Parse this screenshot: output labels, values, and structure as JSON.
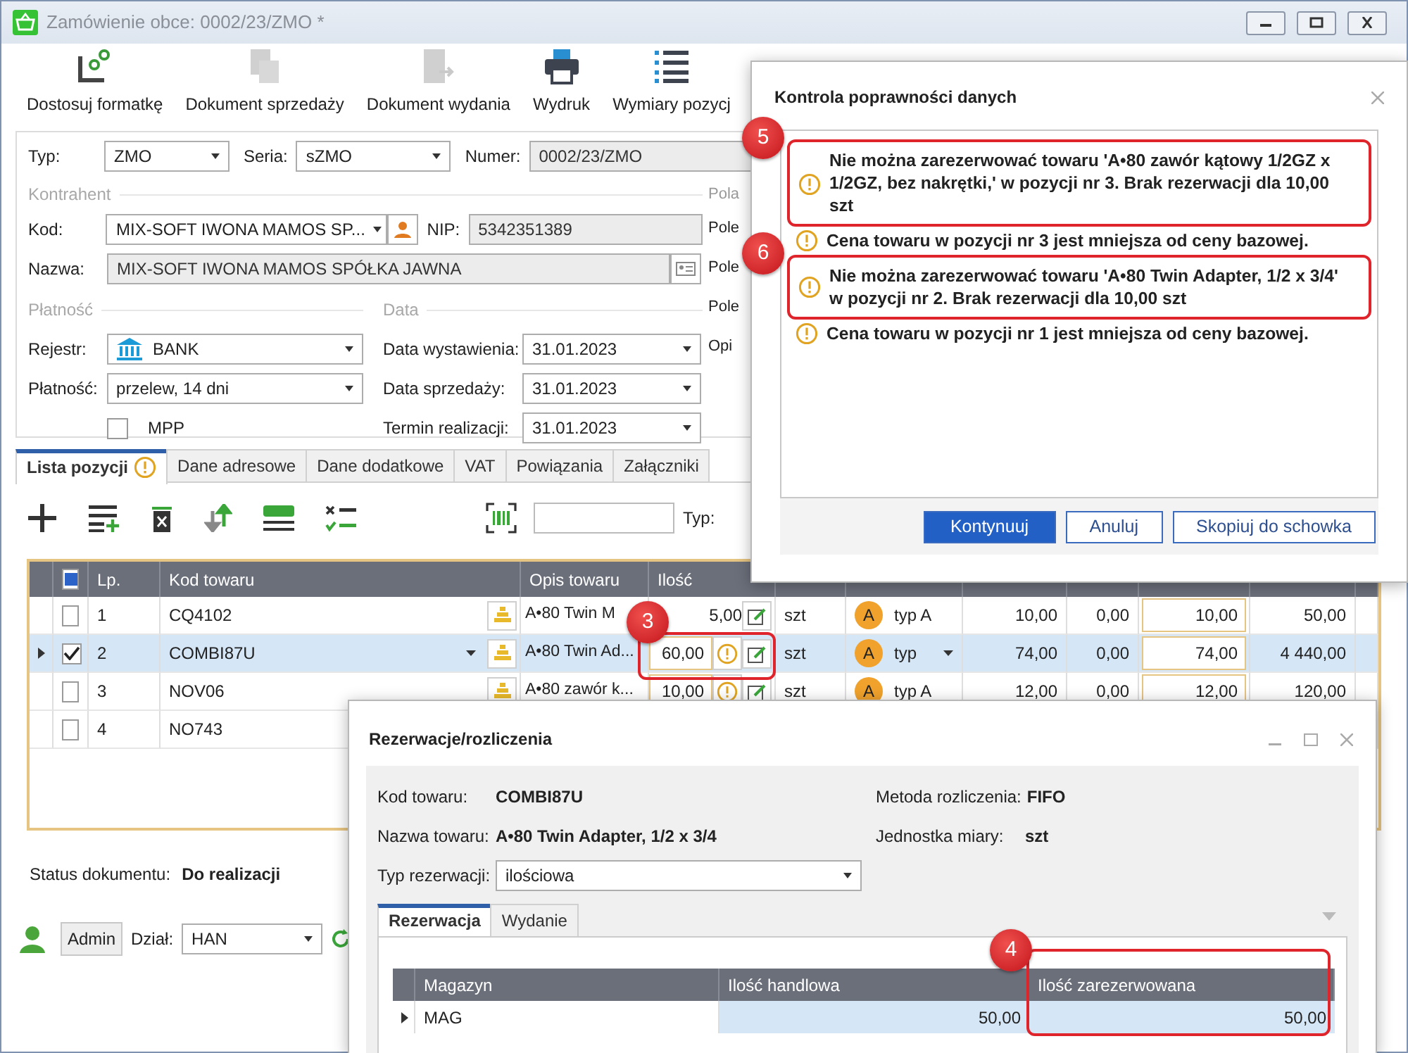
{
  "window": {
    "title": "Zamówienie obce: 0002/23/ZMO *"
  },
  "toolbar": [
    {
      "label": "Dostosuj formatkę",
      "kind": "customize",
      "disabled": false
    },
    {
      "label": "Dokument sprzedaży",
      "kind": "document",
      "disabled": true
    },
    {
      "label": "Dokument wydania",
      "kind": "export",
      "disabled": true
    },
    {
      "label": "Wydruk",
      "kind": "print",
      "disabled": false
    },
    {
      "label": "Wymiary pozycj",
      "kind": "list",
      "disabled": false
    }
  ],
  "header": {
    "typ_label": "Typ:",
    "typ": "ZMO",
    "seria_label": "Seria:",
    "seria": "sZMO",
    "numer_label": "Numer:",
    "numer": "0002/23/ZMO"
  },
  "kontrahent": {
    "title": "Kontrahent",
    "kod_label": "Kod:",
    "kod": "MIX-SOFT IWONA MAMOS SP...",
    "nip_label": "NIP:",
    "nip": "5342351389",
    "nazwa_label": "Nazwa:",
    "nazwa": "MIX-SOFT IWONA MAMOS SPÓŁKA JAWNA"
  },
  "platnosc": {
    "title": "Płatność",
    "rejestr_label": "Rejestr:",
    "rejestr": "BANK",
    "platnosc_label": "Płatność:",
    "platnosc": "przelew, 14 dni",
    "mpp_label": "MPP",
    "mpp_checked": false
  },
  "data": {
    "title": "Data",
    "fields": [
      {
        "label": "Data wystawienia:",
        "value": "31.01.2023"
      },
      {
        "label": "Data sprzedaży:",
        "value": "31.01.2023"
      },
      {
        "label": "Termin realizacji:",
        "value": "31.01.2023"
      }
    ]
  },
  "pola": {
    "title": "Pola",
    "labels": [
      "Pole",
      "Pole",
      "Pole",
      "Opi"
    ]
  },
  "tabs": [
    {
      "label": "Lista pozycji",
      "selected": true,
      "warning": true
    },
    {
      "label": "Dane adresowe",
      "selected": false,
      "warning": false
    },
    {
      "label": "Dane dodatkowe",
      "selected": false,
      "warning": false
    },
    {
      "label": "VAT",
      "selected": false,
      "warning": false
    },
    {
      "label": "Powiązania",
      "selected": false,
      "warning": false
    },
    {
      "label": "Załączniki",
      "selected": false,
      "warning": false
    }
  ],
  "grid_toolbar": {
    "typ_label": "Typ:"
  },
  "items": {
    "select_all_partial": true,
    "columns": [
      "Lp.",
      "Kod towaru",
      "Opis towaru",
      "Ilość"
    ],
    "rows": [
      {
        "lp": "1",
        "selected": false,
        "checked": false,
        "kod": "CQ4102",
        "opis": "A•80 Twin M",
        "ilosc": "5,00",
        "warning": false,
        "jm": "szt",
        "price_badge": "A",
        "typ_ceny": "typ A",
        "cena_cennik": "10,00",
        "rabat": "0,00",
        "cena_netto": "10,00",
        "wartosc": "50,00"
      },
      {
        "lp": "2",
        "selected": true,
        "checked": true,
        "kod": "COMBI87U",
        "opis": "A•80 Twin Ad...",
        "ilosc": "60,00",
        "warning": true,
        "marker": "3",
        "jm": "szt",
        "price_badge": "A",
        "typ_ceny": "typ",
        "cena_cennik": "74,00",
        "rabat": "0,00",
        "cena_netto": "74,00",
        "wartosc": "4 440,00"
      },
      {
        "lp": "3",
        "selected": false,
        "checked": false,
        "kod": "NOV06",
        "opis": "A•80 zawór k...",
        "ilosc": "10,00",
        "warning": true,
        "jm": "szt",
        "price_badge": "A",
        "typ_ceny": "typ A",
        "cena_cennik": "12,00",
        "rabat": "0,00",
        "cena_netto": "12,00",
        "wartosc": "120,00"
      },
      {
        "lp": "4",
        "selected": false,
        "checked": false,
        "kod": "NO743"
      }
    ]
  },
  "status": {
    "label": "Status dokumentu:",
    "value": "Do realizacji"
  },
  "footer": {
    "user": "Admin",
    "dzial_label": "Dział:",
    "dzial": "HAN"
  },
  "validation_dialog": {
    "title": "Kontrola poprawności danych",
    "messages": [
      {
        "text": "Nie można zarezerwować towaru 'A•80 zawór kątowy 1/2GZ x 1/2GZ, bez nakrętki,' w pozycji nr 3. Brak rezerwacji dla 10,00 szt",
        "highlighted": true,
        "marker": "5"
      },
      {
        "text": "Cena towaru w pozycji nr 3 jest mniejsza od ceny bazowej.",
        "highlighted": false
      },
      {
        "text": "Nie można zarezerwować towaru 'A•80 Twin Adapter, 1/2 x 3/4' w pozycji nr 2. Brak rezerwacji dla 10,00 szt",
        "highlighted": true,
        "marker": "6"
      },
      {
        "text": "Cena towaru w pozycji nr 1 jest mniejsza od ceny bazowej.",
        "highlighted": false
      }
    ],
    "buttons": [
      {
        "label": "Kontynuuj",
        "kind": "primary"
      },
      {
        "label": "Anuluj",
        "kind": "secondary"
      },
      {
        "label": "Skopiuj do schowka",
        "kind": "secondary"
      }
    ]
  },
  "reservation_dialog": {
    "title": "Rezerwacje/rozliczenia",
    "kod_label": "Kod towaru:",
    "kod": "COMBI87U",
    "metoda_label": "Metoda rozliczenia:",
    "metoda": "FIFO",
    "nazwa_label": "Nazwa towaru:",
    "nazwa": "A•80 Twin Adapter, 1/2 x 3/4",
    "jm_label": "Jednostka miary:",
    "jm": "szt",
    "typ_label": "Typ rezerwacji:",
    "typ": "ilościowa",
    "tabs": [
      {
        "label": "Rezerwacja",
        "selected": true
      },
      {
        "label": "Wydanie",
        "selected": false
      }
    ],
    "columns": [
      "Magazyn",
      "Ilość handlowa",
      "Ilość zarezerwowana"
    ],
    "highlight_column_marker": "4",
    "rows": [
      {
        "magazyn": "MAG",
        "ilosc_handlowa": "50,00",
        "ilosc_zarezerwowana": "50,00"
      }
    ]
  }
}
